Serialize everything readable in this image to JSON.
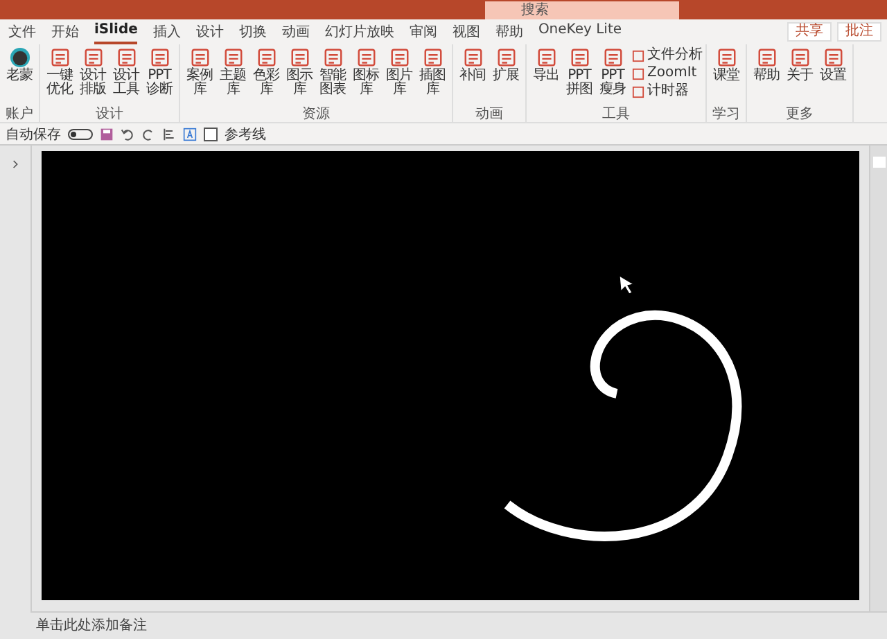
{
  "search": {
    "placeholder": "搜索"
  },
  "header_buttons": [
    "共享",
    "批注"
  ],
  "tabs": [
    {
      "label": "文件",
      "selected": false
    },
    {
      "label": "开始",
      "selected": false
    },
    {
      "label": "iSlide",
      "selected": true
    },
    {
      "label": "插入",
      "selected": false
    },
    {
      "label": "设计",
      "selected": false
    },
    {
      "label": "切换",
      "selected": false
    },
    {
      "label": "动画",
      "selected": false
    },
    {
      "label": "幻灯片放映",
      "selected": false
    },
    {
      "label": "审阅",
      "selected": false
    },
    {
      "label": "视图",
      "selected": false
    },
    {
      "label": "帮助",
      "selected": false
    },
    {
      "label": "OneKey Lite",
      "selected": false
    }
  ],
  "ribbon": [
    {
      "group": "账户",
      "kind": "avatar",
      "items": [
        "老蒙"
      ]
    },
    {
      "group": "设计",
      "kind": "large",
      "items": [
        "一键优化",
        "设计排版",
        "设计工具",
        "PPT诊断"
      ]
    },
    {
      "group": "资源",
      "kind": "large",
      "items": [
        "案例库",
        "主题库",
        "色彩库",
        "图示库",
        "智能图表",
        "图标库",
        "图片库",
        "插图库"
      ]
    },
    {
      "group": "动画",
      "kind": "large",
      "items": [
        "补间",
        "扩展"
      ]
    },
    {
      "group": "工具",
      "kind": "large",
      "items": [
        "导出",
        "PPT拼图",
        "PPT瘦身"
      ],
      "small_items": [
        "文件分析",
        "ZoomIt",
        "计时器"
      ]
    },
    {
      "group": "学习",
      "kind": "large",
      "items": [
        "课堂"
      ]
    },
    {
      "group": "更多",
      "kind": "large",
      "items": [
        "帮助",
        "关于",
        "设置"
      ]
    }
  ],
  "quick_access": {
    "autosave_label": "自动保存",
    "autosave_on": false,
    "guides_label": "参考线",
    "guides_checked": false
  },
  "notes": {
    "placeholder": "单击此处添加备注"
  }
}
